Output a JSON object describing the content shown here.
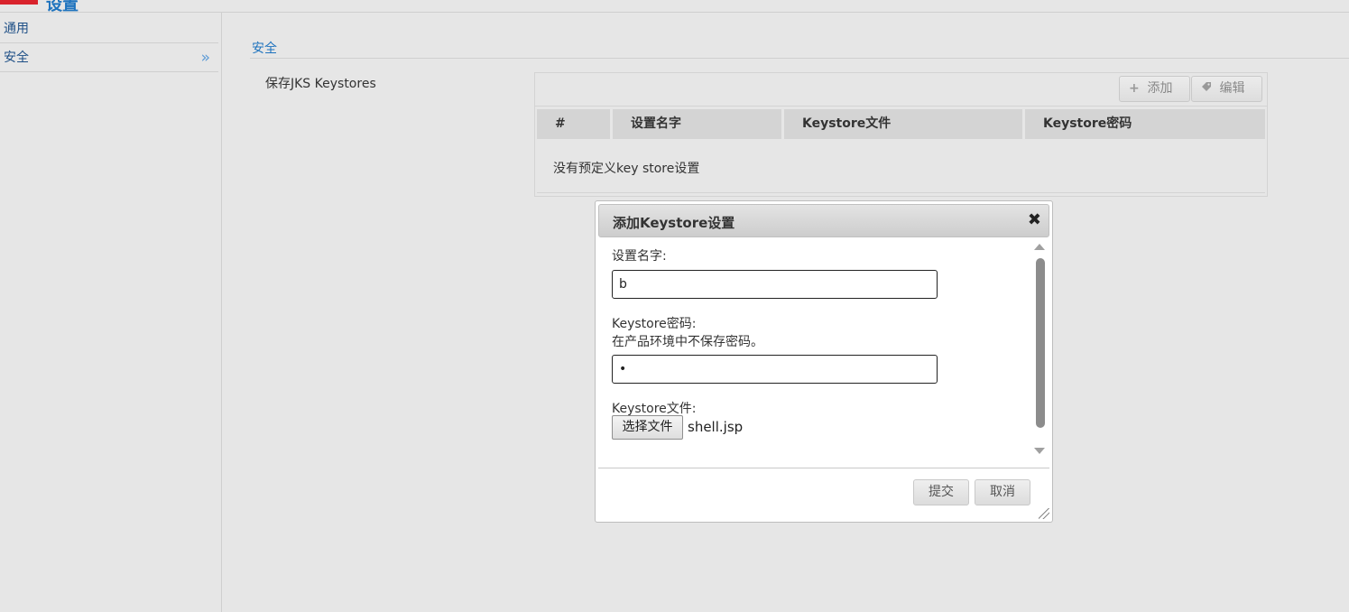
{
  "header": {
    "title": "设置"
  },
  "sidebar": {
    "items": [
      {
        "label": "通用"
      },
      {
        "label": "安全",
        "indicator": "»"
      }
    ]
  },
  "main": {
    "section_title": "安全",
    "field_label": "保存JKS Keystores",
    "toolbar": {
      "add_label": "添加",
      "edit_label": "编辑"
    },
    "table": {
      "columns": [
        "#",
        "设置名字",
        "Keystore文件",
        "Keystore密码"
      ],
      "empty_message": "没有预定义key store设置"
    }
  },
  "dialog": {
    "title": "添加Keystore设置",
    "close_glyph": "✖",
    "name_label": "设置名字:",
    "name_value": "b",
    "password_label": "Keystore密码:",
    "password_hint": "在产品环境中不保存密码。",
    "password_value": "•",
    "file_label": "Keystore文件:",
    "file_button": "选择文件",
    "file_name": "shell.jsp",
    "submit_label": "提交",
    "cancel_label": "取消"
  }
}
